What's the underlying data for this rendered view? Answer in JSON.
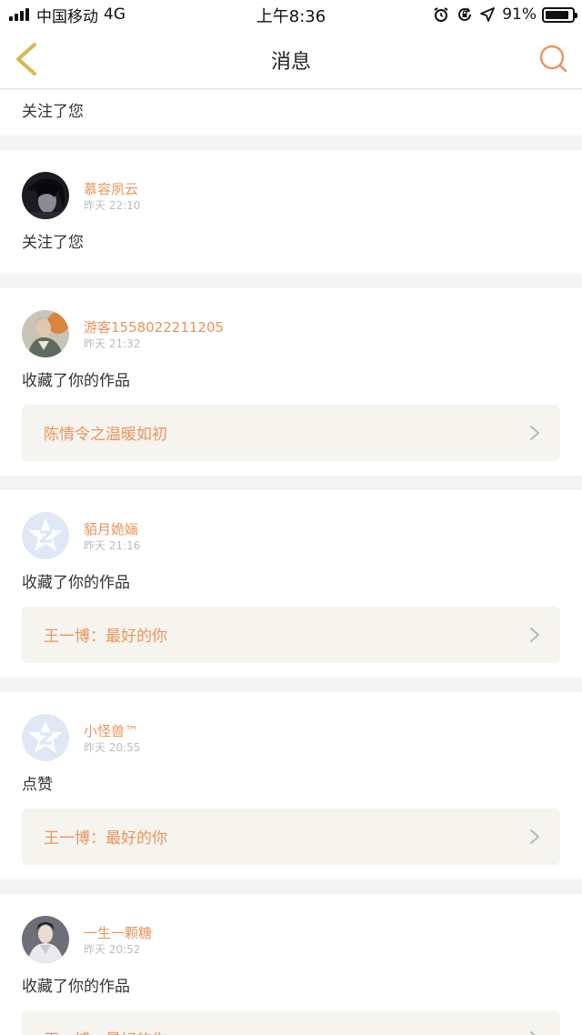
{
  "status_bar": {
    "carrier": "中国移动",
    "network": "4G",
    "time": "上午8:36",
    "battery_text": "91%",
    "battery_level": 0.91,
    "icons": [
      "signal-icon",
      "alarm-icon",
      "rotation-lock-icon",
      "location-arrow-icon",
      "battery-icon"
    ]
  },
  "nav": {
    "title": "消息",
    "back_icon": "chevron-left-icon",
    "search_icon": "search-icon"
  },
  "colors": {
    "accent": "#e9955d",
    "back_icon": "#d9b84a",
    "work_background": "#f5f4ee",
    "separator": "#f4f3f6"
  },
  "notifications": [
    {
      "action": "关注了您"
    },
    {
      "username": "慕容夙云",
      "time": "昨天 22:10",
      "action": "关注了您",
      "avatar": "photo-avatar-dark"
    },
    {
      "username": "游客1558022211205",
      "time": "昨天 21:32",
      "action": "收藏了你的作品",
      "work": "陈情令之温暖如初",
      "avatar": "photo-avatar-costume"
    },
    {
      "username": "貊月姽婳",
      "time": "昨天 21:16",
      "action": "收藏了你的作品",
      "work": "王一博：最好的你",
      "avatar": "default-avatar-icon"
    },
    {
      "username": "小怪兽™",
      "time": "昨天 20:55",
      "action": "点赞",
      "work": "王一博：最好的你",
      "avatar": "default-avatar-icon"
    },
    {
      "username": "一生一颗糖",
      "time": "昨天 20:52",
      "action": "收藏了你的作品",
      "work": "王一博：最好的你",
      "avatar": "photo-avatar-costume"
    }
  ]
}
